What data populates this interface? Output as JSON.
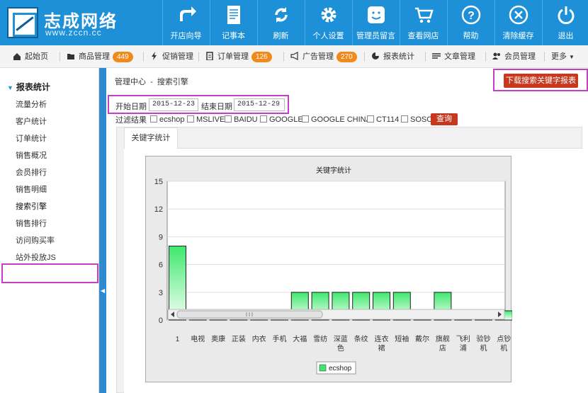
{
  "header": {
    "logo_name": "志成网络",
    "logo_url": "www.zccn.cc",
    "tools": [
      {
        "label": "开店向导",
        "icon": "share-arrow-icon"
      },
      {
        "label": "记事本",
        "icon": "notepad-icon"
      },
      {
        "label": "刷新",
        "icon": "refresh-icon"
      },
      {
        "label": "个人设置",
        "icon": "gear-icon"
      },
      {
        "label": "管理员留言",
        "icon": "smiley-icon"
      },
      {
        "label": "查看网店",
        "icon": "cart-icon"
      },
      {
        "label": "帮助",
        "icon": "help-icon"
      },
      {
        "label": "清除缓存",
        "icon": "clear-icon"
      },
      {
        "label": "退出",
        "icon": "power-icon"
      }
    ]
  },
  "nav": {
    "items": [
      {
        "label": "起始页",
        "icon": "home-icon"
      },
      {
        "label": "商品管理",
        "icon": "folder-icon",
        "badge": "449"
      },
      {
        "label": "促销管理",
        "icon": "bolt-icon"
      },
      {
        "label": "订单管理",
        "icon": "clipboard-icon",
        "badge": "126"
      },
      {
        "label": "广告管理",
        "icon": "megaphone-icon",
        "badge": "270"
      },
      {
        "label": "报表统计",
        "icon": "pie-chart-icon"
      },
      {
        "label": "文章管理",
        "icon": "list-icon"
      },
      {
        "label": "会员管理",
        "icon": "users-icon"
      },
      {
        "label": "更多",
        "icon": "caret-down-icon"
      }
    ]
  },
  "sidebar": {
    "heading": "报表统计",
    "items": [
      "流量分析",
      "客户统计",
      "订单统计",
      "销售概况",
      "会员排行",
      "销售明细",
      "搜索引擎",
      "销售排行",
      "访问购买率",
      "站外投放JS"
    ],
    "active": "搜索引擎"
  },
  "main": {
    "breadcrumb": "管理中心  -  搜索引擎",
    "download_label": "下载搜索关键字报表",
    "start_label": "开始日期",
    "start_value": "2015-12-23",
    "end_label": "结束日期",
    "end_value": "2015-12-29",
    "filter_label": "过滤结果",
    "filters": [
      "ecshop",
      "MSLIVE",
      "BAIDU",
      "GOOGLE",
      "GOOGLE CHINA",
      "CT114",
      "SOSO"
    ],
    "query_label": "查询",
    "tab_label": "关键字统计"
  },
  "colors": {
    "header_bg": "#1e90d8",
    "accent_red": "#c6391f",
    "badge_orange": "#f08a1c",
    "highlight_magenta": "#c43fc4",
    "bar_green": "#3ee86e"
  },
  "chart_data": {
    "type": "bar",
    "title": "关键字统计",
    "categories": [
      "1",
      "电视",
      "奥康",
      "正装",
      "内衣",
      "手机",
      "大福",
      "雪纺",
      "深蓝色",
      "条纹",
      "连衣裙",
      "短袖",
      "戴尔",
      "旗舰店",
      "飞利浦",
      "验钞机",
      "点钞机"
    ],
    "category_lines": [
      [
        "1"
      ],
      [
        "电视"
      ],
      [
        "奥康"
      ],
      [
        "正装"
      ],
      [
        "内衣"
      ],
      [
        "手机"
      ],
      [
        "大福"
      ],
      [
        "雪纺"
      ],
      [
        "深蓝",
        "色"
      ],
      [
        "条纹"
      ],
      [
        "连衣",
        "裙"
      ],
      [
        "短袖"
      ],
      [
        "戴尔"
      ],
      [
        "旗舰",
        "店"
      ],
      [
        "飞利",
        "浦"
      ],
      [
        "验钞",
        "机"
      ],
      [
        "点钞",
        "机"
      ]
    ],
    "series": [
      {
        "name": "ecshop",
        "values": [
          8,
          1,
          1,
          1,
          1,
          1,
          3,
          3,
          3,
          3,
          3,
          3,
          1,
          3,
          1,
          1,
          1
        ]
      }
    ],
    "yticks": [
      0,
      3,
      6,
      9,
      12,
      15
    ],
    "ylim": [
      0,
      15
    ],
    "grid": true,
    "legend": "bottom"
  }
}
